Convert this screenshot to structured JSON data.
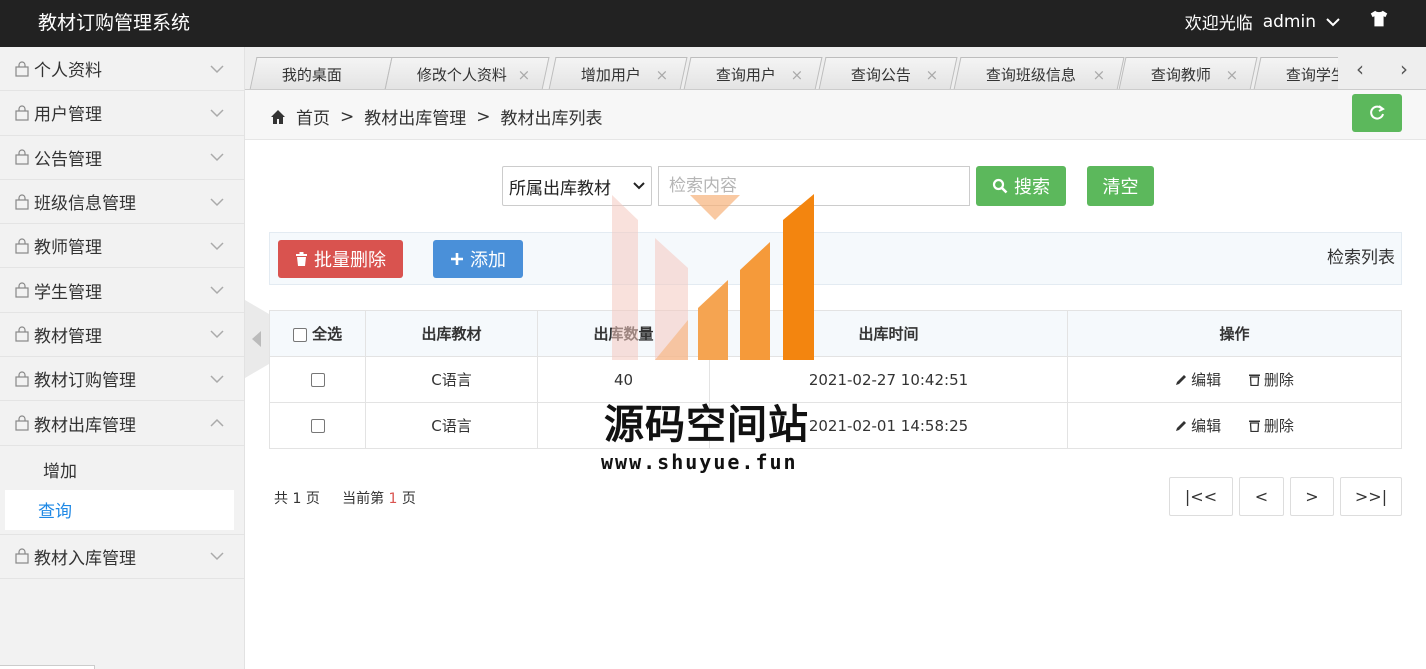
{
  "header": {
    "title": "教材订购管理系统",
    "welcome": "欢迎光临",
    "user": "admin"
  },
  "sidebar": {
    "items": [
      {
        "label": "个人资料"
      },
      {
        "label": "用户管理"
      },
      {
        "label": "公告管理"
      },
      {
        "label": "班级信息管理"
      },
      {
        "label": "教师管理"
      },
      {
        "label": "学生管理"
      },
      {
        "label": "教材管理"
      },
      {
        "label": "教材订购管理"
      },
      {
        "label": "教材出库管理",
        "expanded": true,
        "children": [
          "增加",
          "查询"
        ],
        "active_child": "查询"
      },
      {
        "label": "教材入库管理"
      }
    ]
  },
  "tabs": [
    "我的桌面",
    "修改个人资料",
    "增加用户",
    "查询用户",
    "查询公告",
    "查询班级信息",
    "查询教师",
    "查询学生"
  ],
  "breadcrumb": [
    "首页",
    "教材出库管理",
    "教材出库列表"
  ],
  "search": {
    "select_value": "所属出库教材",
    "placeholder": "检索内容",
    "search_label": "搜索",
    "clear_label": "清空"
  },
  "toolbar": {
    "batch_delete_label": "批量删除",
    "add_label": "添加",
    "caption": "检索列表"
  },
  "table": {
    "headers": [
      "全选",
      "出库教材",
      "出库数量",
      "出库时间",
      "操作"
    ],
    "rows": [
      {
        "book": "C语言",
        "qty": "40",
        "time": "2021-02-27 10:42:51"
      },
      {
        "book": "C语言",
        "qty": "",
        "time": "2021-02-01 14:58:25"
      }
    ],
    "edit_label": "编辑",
    "delete_label": "删除"
  },
  "pagination": {
    "total_prefix": "共",
    "total_pages": "1",
    "total_suffix": "页",
    "current_prefix": "当前第",
    "current_page": "1",
    "current_suffix": "页",
    "first": "|<<",
    "prev": "<",
    "next": ">",
    "last": ">>|"
  },
  "watermark": {
    "text": "源码空间站",
    "url": "www.shuyue.fun"
  },
  "colors": {
    "header_bg": "#222222",
    "green": "#5cb85c",
    "red": "#d9534f",
    "blue": "#4a90d9",
    "active_link": "#1e88e5"
  }
}
